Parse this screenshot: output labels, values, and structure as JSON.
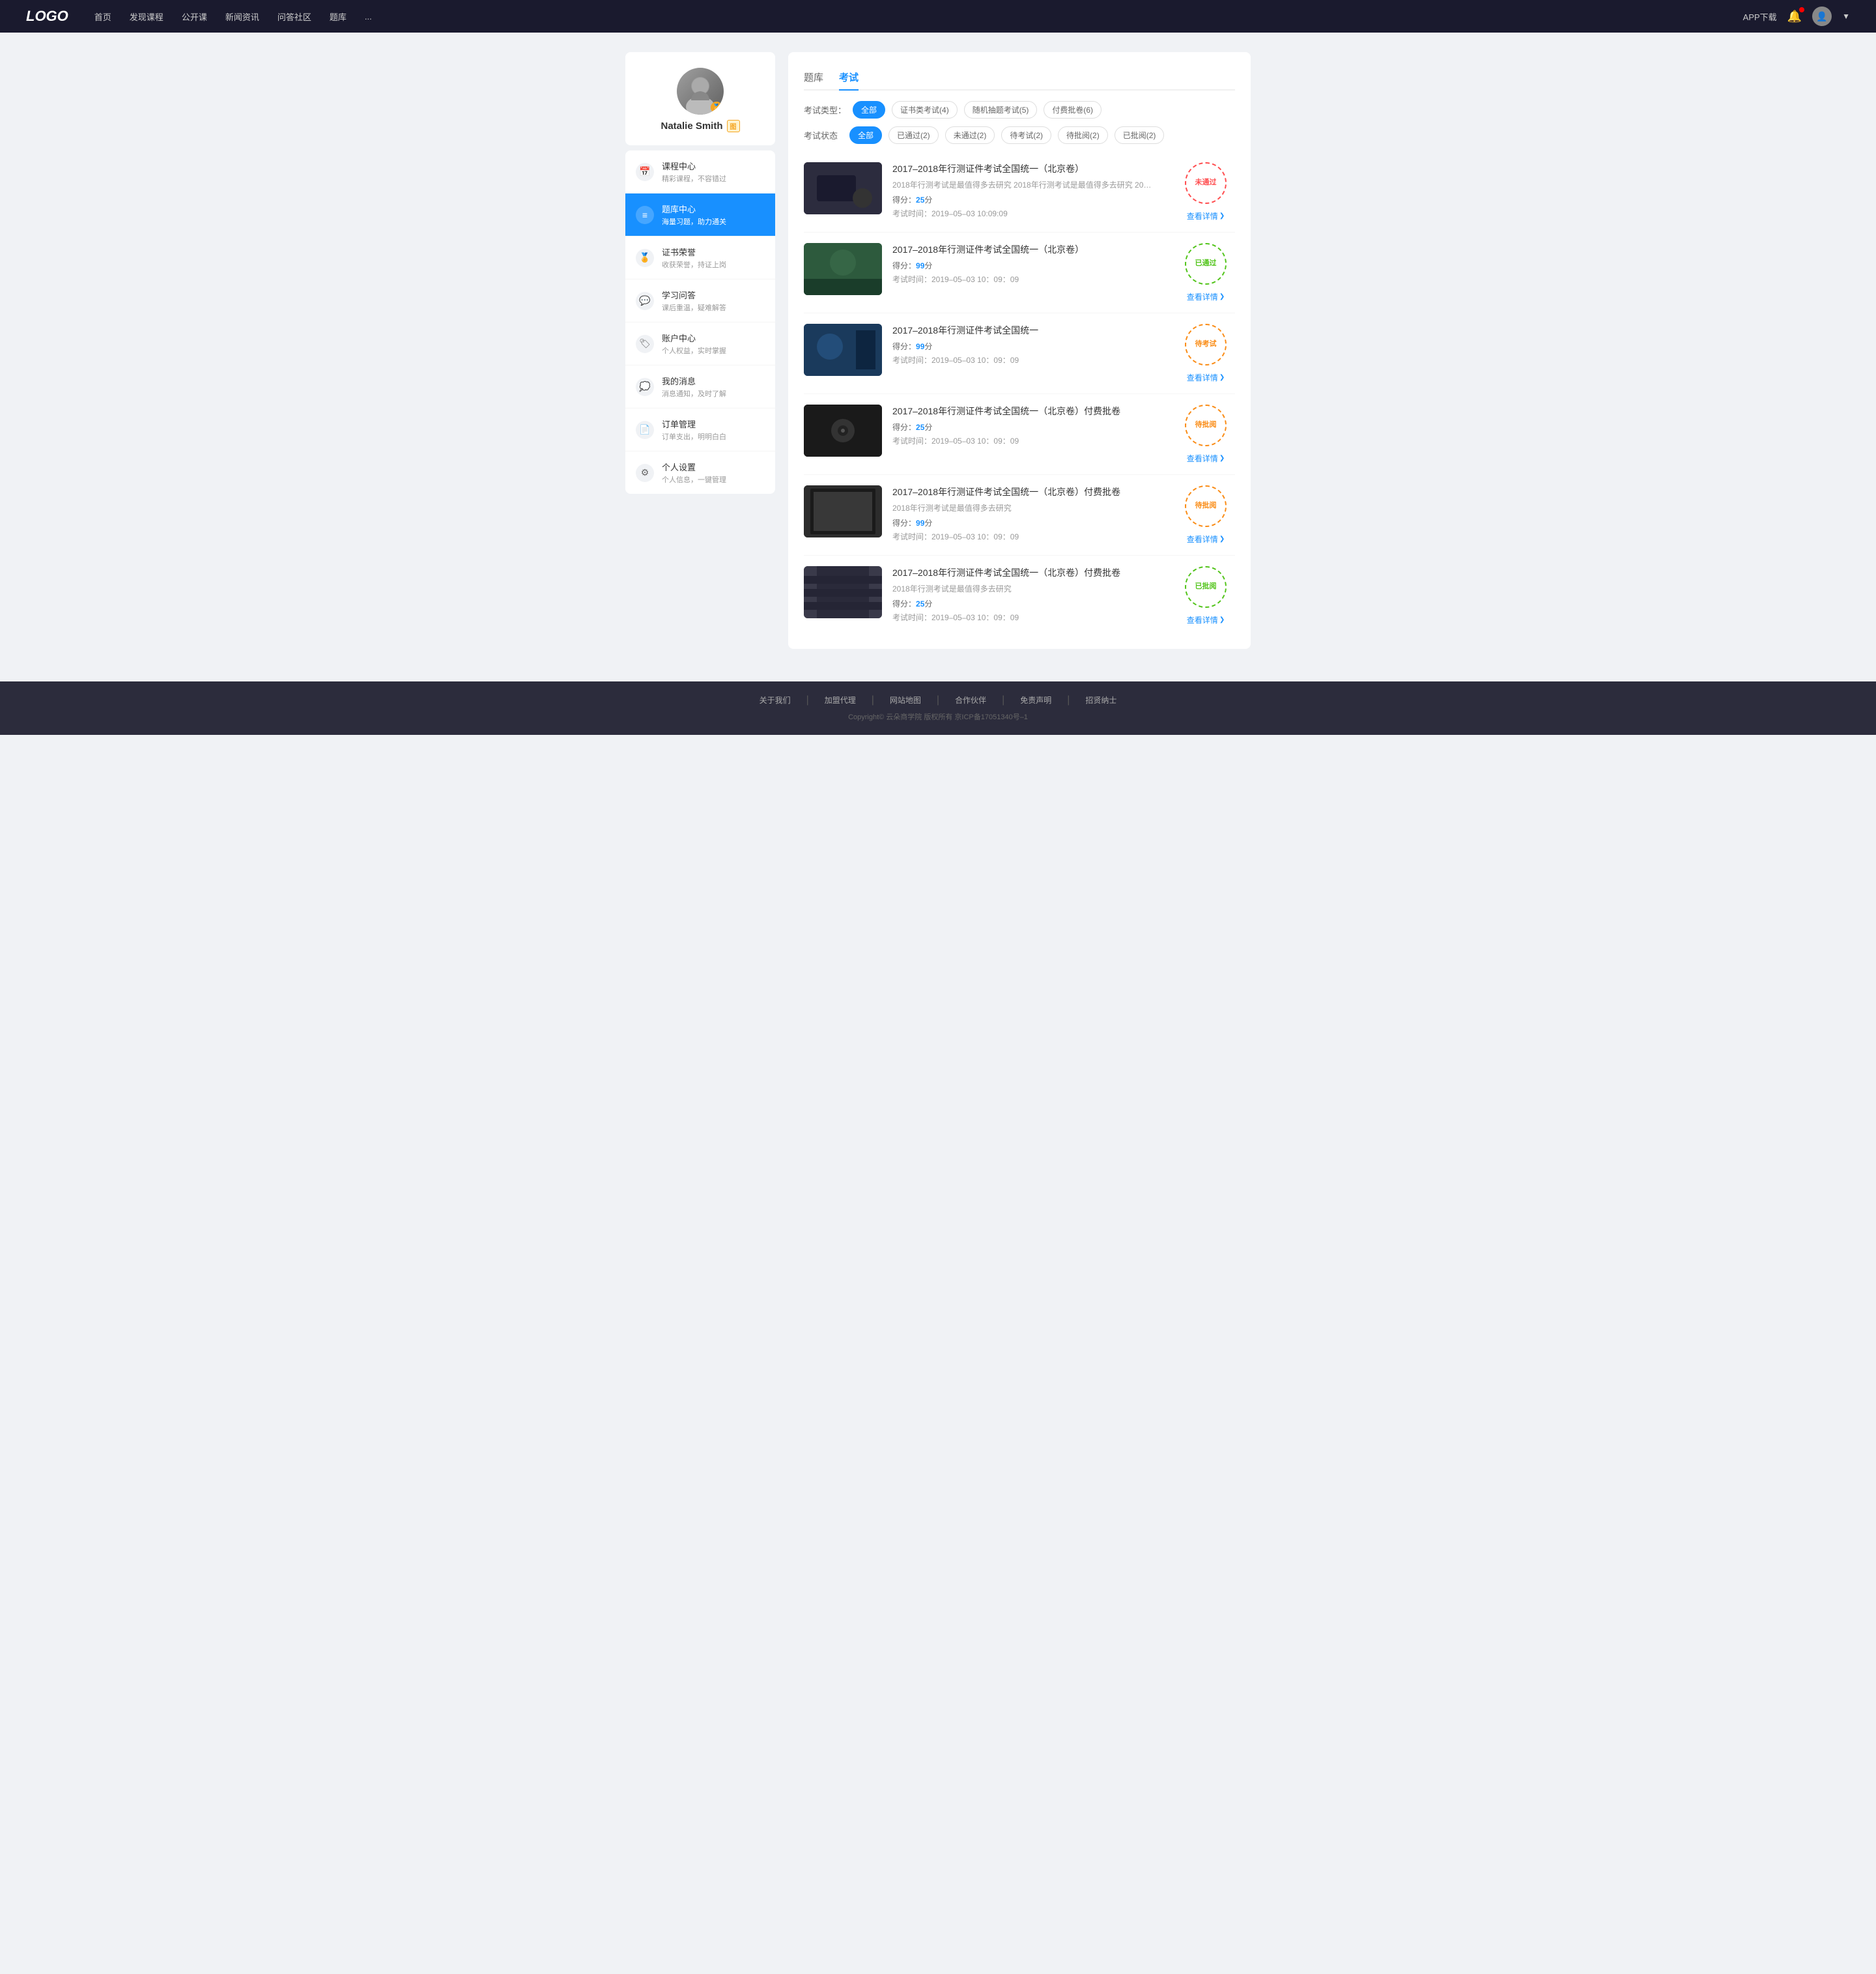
{
  "header": {
    "logo": "LOGO",
    "nav": [
      {
        "label": "首页",
        "id": "nav-home"
      },
      {
        "label": "发现课程",
        "id": "nav-discover"
      },
      {
        "label": "公开课",
        "id": "nav-opencourse"
      },
      {
        "label": "新闻资讯",
        "id": "nav-news"
      },
      {
        "label": "问答社区",
        "id": "nav-qa"
      },
      {
        "label": "题库",
        "id": "nav-questionbank"
      },
      {
        "label": "...",
        "id": "nav-more"
      }
    ],
    "appDownload": "APP下载",
    "userDropdownArrow": "▼"
  },
  "sidebar": {
    "username": "Natalie Smith",
    "vipLabel": "图",
    "menu": [
      {
        "id": "course-center",
        "icon": "📅",
        "title": "课程中心",
        "sub": "精彩课程，不容错过"
      },
      {
        "id": "question-bank",
        "icon": "≡",
        "title": "题库中心",
        "sub": "海量习题，助力通关",
        "active": true
      },
      {
        "id": "certificate",
        "icon": "🏅",
        "title": "证书荣誉",
        "sub": "收获荣誉，持证上岗"
      },
      {
        "id": "qa",
        "icon": "💬",
        "title": "学习问答",
        "sub": "课后重温，疑难解答"
      },
      {
        "id": "account",
        "icon": "🏷",
        "title": "账户中心",
        "sub": "个人权益，实时掌握"
      },
      {
        "id": "messages",
        "icon": "💭",
        "title": "我的消息",
        "sub": "消息通知，及时了解"
      },
      {
        "id": "orders",
        "icon": "📄",
        "title": "订单管理",
        "sub": "订单支出，明明白白"
      },
      {
        "id": "settings",
        "icon": "⚙",
        "title": "个人设置",
        "sub": "个人信息，一键管理"
      }
    ]
  },
  "content": {
    "tabs": [
      {
        "label": "题库",
        "id": "tab-bank"
      },
      {
        "label": "考试",
        "id": "tab-exam",
        "active": true
      }
    ],
    "typeFilter": {
      "label": "考试类型：",
      "options": [
        {
          "label": "全部",
          "active": true
        },
        {
          "label": "证书类考试(4)"
        },
        {
          "label": "随机抽题考试(5)"
        },
        {
          "label": "付费批卷(6)"
        }
      ]
    },
    "statusFilter": {
      "label": "考试状态",
      "options": [
        {
          "label": "全部",
          "active": true
        },
        {
          "label": "已通过(2)"
        },
        {
          "label": "未通过(2)"
        },
        {
          "label": "待考试(2)"
        },
        {
          "label": "待批阅(2)"
        },
        {
          "label": "已批阅(2)"
        }
      ]
    },
    "exams": [
      {
        "id": "exam-1",
        "title": "2017–2018年行测证件考试全国统一（北京卷）",
        "desc": "2018年行测考试是最值得多去研究 2018年行测考试是最值得多去研究 2018年行…",
        "score": "25",
        "time": "2019–05–03  10:09:09",
        "status": "未通过",
        "statusType": "fail",
        "thumbClass": "thumb-1",
        "detailLabel": "查看详情"
      },
      {
        "id": "exam-2",
        "title": "2017–2018年行测证件考试全国统一（北京卷）",
        "desc": "",
        "score": "99",
        "time": "2019–05–03  10：09：09",
        "status": "已通过",
        "statusType": "pass",
        "thumbClass": "thumb-2",
        "detailLabel": "查看详情"
      },
      {
        "id": "exam-3",
        "title": "2017–2018年行测证件考试全国统一",
        "desc": "",
        "score": "99",
        "time": "2019–05–03  10：09：09",
        "status": "待考试",
        "statusType": "pending",
        "thumbClass": "thumb-3",
        "detailLabel": "查看详情"
      },
      {
        "id": "exam-4",
        "title": "2017–2018年行测证件考试全国统一（北京卷）付费批卷",
        "desc": "",
        "score": "25",
        "time": "2019–05–03  10：09：09",
        "status": "待批阅",
        "statusType": "wait-review",
        "thumbClass": "thumb-4",
        "detailLabel": "查看详情"
      },
      {
        "id": "exam-5",
        "title": "2017–2018年行测证件考试全国统一（北京卷）付费批卷",
        "desc": "2018年行测考试是最值得多去研究",
        "score": "99",
        "time": "2019–05–03  10：09：09",
        "status": "待批阅",
        "statusType": "wait-review",
        "thumbClass": "thumb-5",
        "detailLabel": "查看详情"
      },
      {
        "id": "exam-6",
        "title": "2017–2018年行测证件考试全国统一（北京卷）付费批卷",
        "desc": "2018年行测考试是最值得多去研究",
        "score": "25",
        "time": "2019–05–03  10：09：09",
        "status": "已批阅",
        "statusType": "reviewed",
        "thumbClass": "thumb-6",
        "detailLabel": "查看详情"
      }
    ]
  },
  "footer": {
    "links": [
      "关于我们",
      "加盟代理",
      "网站地图",
      "合作伙伴",
      "免责声明",
      "招贤纳士"
    ],
    "copyright": "Copyright© 云朵商学院  版权所有    京ICP备17051340号–1"
  }
}
